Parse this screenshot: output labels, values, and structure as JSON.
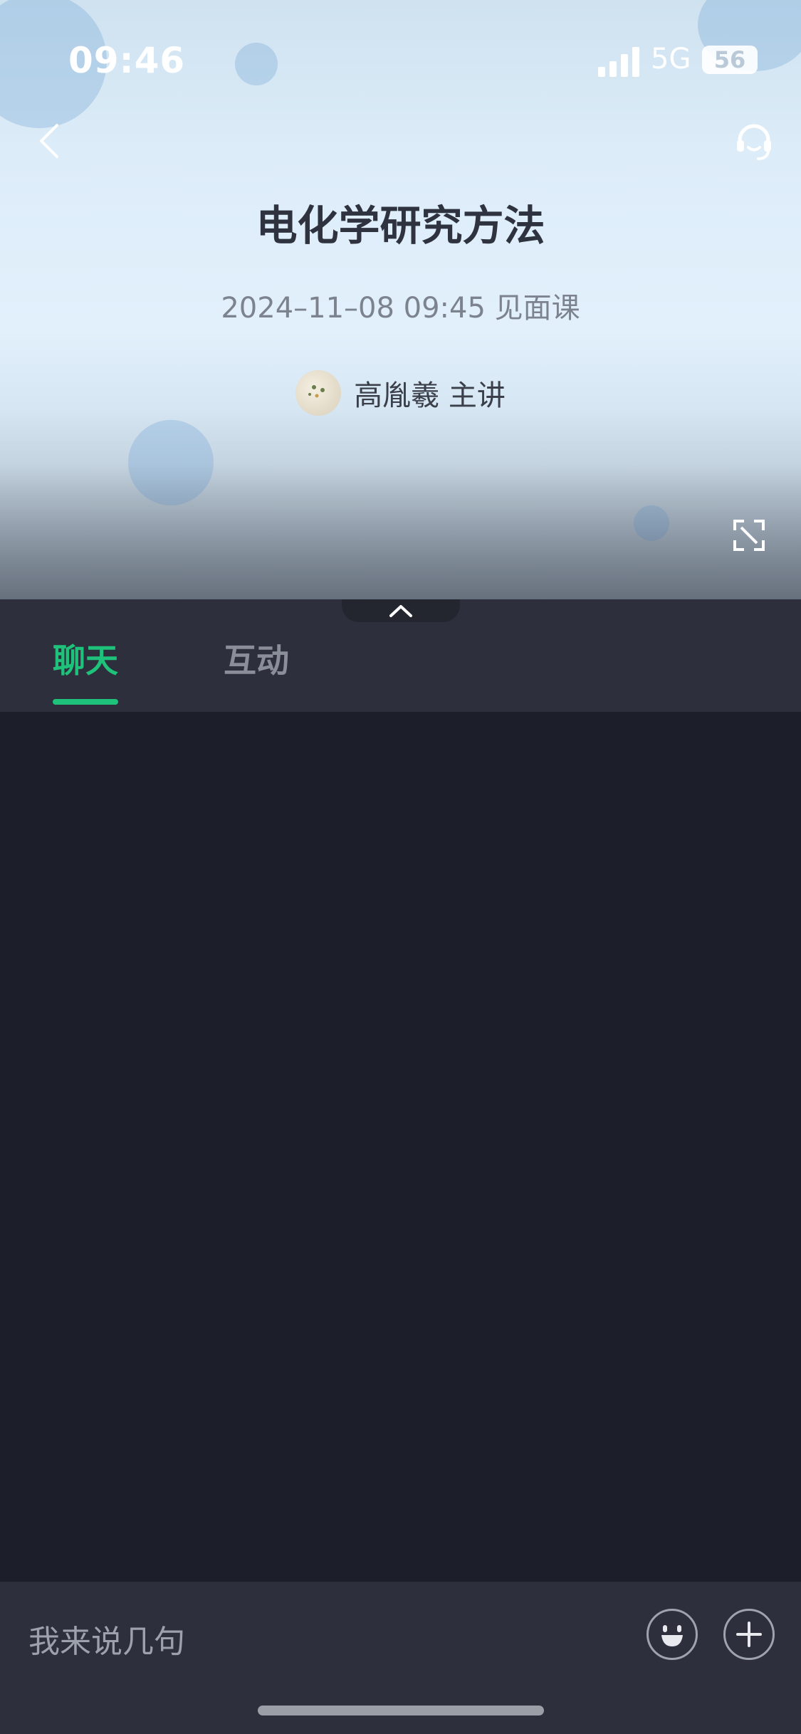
{
  "status_bar": {
    "time": "09:46",
    "network": "5G",
    "battery": "56"
  },
  "course": {
    "title": "电化学研究方法",
    "subtitle": "2024–11–08 09:45 见面课",
    "lecturer": "高胤羲 主讲"
  },
  "tabs": [
    {
      "label": "聊天",
      "active": true
    },
    {
      "label": "互动",
      "active": false
    }
  ],
  "input": {
    "placeholder": "我来说几句"
  },
  "colors": {
    "accent": "#1fc27a",
    "panel": "#2d2f3c",
    "background": "#1c1e29"
  },
  "icons": {
    "back": "back-arrow-icon",
    "service": "headset-icon",
    "fullscreen": "fullscreen-icon",
    "collapse": "chevron-up-icon",
    "emoji": "emoji-icon",
    "add": "plus-icon"
  }
}
